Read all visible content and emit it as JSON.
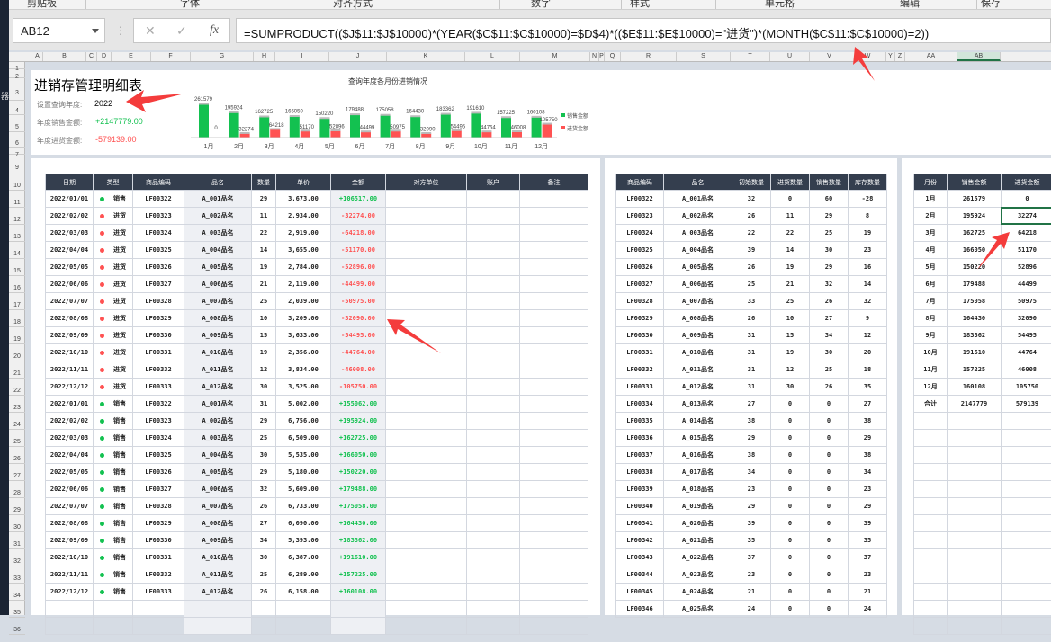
{
  "ribbon": {
    "groups": [
      "剪贴板",
      "字体",
      "对齐方式",
      "数字",
      "样式",
      "单元格",
      "编辑",
      "保存"
    ]
  },
  "desktop": {
    "label": "器"
  },
  "formula_bar": {
    "name_box": "AB12",
    "cancel_icon": "✕",
    "confirm_icon": "✓",
    "fx_label": "fx",
    "formula": "=SUMPRODUCT(($J$11:$J$10000)*(YEAR($C$11:$C$10000)=$D$4)*(($E$11:$E$10000)=\"进货\")*(MONTH($C$11:$C$10000)=2))"
  },
  "columns": [
    "A",
    "B",
    "C",
    "D",
    "E",
    "F",
    "G",
    "H",
    "I",
    "J",
    "K",
    "L",
    "M",
    "N",
    "P",
    "Q",
    "R",
    "S",
    "T",
    "U",
    "V",
    "W",
    "Y",
    "Z",
    "AA",
    "AB"
  ],
  "selected_column": "AB",
  "rows": [
    "1",
    "2",
    "3",
    "4",
    "5",
    "6",
    "7",
    "9",
    "10",
    "11",
    "12",
    "13",
    "14",
    "15",
    "16",
    "17",
    "18",
    "19",
    "20",
    "21",
    "22",
    "23",
    "24",
    "25",
    "26",
    "27",
    "28",
    "29",
    "30",
    "31",
    "32",
    "33",
    "34",
    "35",
    "36"
  ],
  "summary": {
    "title": "进销存管理明细表",
    "year_label": "设置查询年度:",
    "year": "2022",
    "sales_label": "年度销售金额:",
    "sales_total": "+2147779.00",
    "purchase_label": "年度进货金额:",
    "purchase_total": "-579139.00"
  },
  "colors": {
    "sales": "#13c150",
    "purchase": "#ff5252",
    "header": "#343e4e",
    "accent": "#217346"
  },
  "chart_data": {
    "type": "bar",
    "title": "查询年度各月份进销情况",
    "categories": [
      "1月",
      "2月",
      "3月",
      "4月",
      "5月",
      "6月",
      "7月",
      "8月",
      "9月",
      "10月",
      "11月",
      "12月"
    ],
    "series": [
      {
        "name": "销售金额",
        "color": "#13c150",
        "values": [
          261579,
          195924,
          162725,
          166050,
          150220,
          179488,
          175058,
          164430,
          183362,
          191610,
          157225,
          160108
        ]
      },
      {
        "name": "进货金额",
        "color": "#ff5252",
        "values": [
          0,
          32274,
          64218,
          51170,
          52896,
          44499,
          50975,
          32090,
          54495,
          44764,
          46008,
          105750
        ]
      }
    ],
    "legend": "right",
    "grid": false,
    "data_labels": true
  },
  "ledger": {
    "headers": [
      "日期",
      "类型",
      "商品编码",
      "品名",
      "数量",
      "单价",
      "金额",
      "对方单位",
      "账户",
      "备注"
    ],
    "rows": [
      [
        "2022/01/01",
        "销售",
        "LF00322",
        "A_001品名",
        "29",
        "3,673.00",
        "+106517.00"
      ],
      [
        "2022/02/02",
        "进货",
        "LF00323",
        "A_002品名",
        "11",
        "2,934.00",
        "-32274.00"
      ],
      [
        "2022/03/03",
        "进货",
        "LF00324",
        "A_003品名",
        "22",
        "2,919.00",
        "-64218.00"
      ],
      [
        "2022/04/04",
        "进货",
        "LF00325",
        "A_004品名",
        "14",
        "3,655.00",
        "-51170.00"
      ],
      [
        "2022/05/05",
        "进货",
        "LF00326",
        "A_005品名",
        "19",
        "2,784.00",
        "-52896.00"
      ],
      [
        "2022/06/06",
        "进货",
        "LF00327",
        "A_006品名",
        "21",
        "2,119.00",
        "-44499.00"
      ],
      [
        "2022/07/07",
        "进货",
        "LF00328",
        "A_007品名",
        "25",
        "2,039.00",
        "-50975.00"
      ],
      [
        "2022/08/08",
        "进货",
        "LF00329",
        "A_008品名",
        "10",
        "3,209.00",
        "-32090.00"
      ],
      [
        "2022/09/09",
        "进货",
        "LF00330",
        "A_009品名",
        "15",
        "3,633.00",
        "-54495.00"
      ],
      [
        "2022/10/10",
        "进货",
        "LF00331",
        "A_010品名",
        "19",
        "2,356.00",
        "-44764.00"
      ],
      [
        "2022/11/11",
        "进货",
        "LF00332",
        "A_011品名",
        "12",
        "3,834.00",
        "-46008.00"
      ],
      [
        "2022/12/12",
        "进货",
        "LF00333",
        "A_012品名",
        "30",
        "3,525.00",
        "-105750.00"
      ],
      [
        "2022/01/01",
        "销售",
        "LF00322",
        "A_001品名",
        "31",
        "5,002.00",
        "+155062.00"
      ],
      [
        "2022/02/02",
        "销售",
        "LF00323",
        "A_002品名",
        "29",
        "6,756.00",
        "+195924.00"
      ],
      [
        "2022/03/03",
        "销售",
        "LF00324",
        "A_003品名",
        "25",
        "6,509.00",
        "+162725.00"
      ],
      [
        "2022/04/04",
        "销售",
        "LF00325",
        "A_004品名",
        "30",
        "5,535.00",
        "+166050.00"
      ],
      [
        "2022/05/05",
        "销售",
        "LF00326",
        "A_005品名",
        "29",
        "5,180.00",
        "+150220.00"
      ],
      [
        "2022/06/06",
        "销售",
        "LF00327",
        "A_006品名",
        "32",
        "5,609.00",
        "+179488.00"
      ],
      [
        "2022/07/07",
        "销售",
        "LF00328",
        "A_007品名",
        "26",
        "6,733.00",
        "+175058.00"
      ],
      [
        "2022/08/08",
        "销售",
        "LF00329",
        "A_008品名",
        "27",
        "6,090.00",
        "+164430.00"
      ],
      [
        "2022/09/09",
        "销售",
        "LF00330",
        "A_009品名",
        "34",
        "5,393.00",
        "+183362.00"
      ],
      [
        "2022/10/10",
        "销售",
        "LF00331",
        "A_010品名",
        "30",
        "6,387.00",
        "+191610.00"
      ],
      [
        "2022/11/11",
        "销售",
        "LF00332",
        "A_011品名",
        "25",
        "6,289.00",
        "+157225.00"
      ],
      [
        "2022/12/12",
        "销售",
        "LF00333",
        "A_012品名",
        "26",
        "6,158.00",
        "+160108.00"
      ]
    ]
  },
  "stock": {
    "headers": [
      "商品编码",
      "品名",
      "初始数量",
      "进货数量",
      "销售数量",
      "库存数量"
    ],
    "rows": [
      [
        "LF00322",
        "A_001品名",
        "32",
        "0",
        "60",
        "-28"
      ],
      [
        "LF00323",
        "A_002品名",
        "26",
        "11",
        "29",
        "8"
      ],
      [
        "LF00324",
        "A_003品名",
        "22",
        "22",
        "25",
        "19"
      ],
      [
        "LF00325",
        "A_004品名",
        "39",
        "14",
        "30",
        "23"
      ],
      [
        "LF00326",
        "A_005品名",
        "26",
        "19",
        "29",
        "16"
      ],
      [
        "LF00327",
        "A_006品名",
        "25",
        "21",
        "32",
        "14"
      ],
      [
        "LF00328",
        "A_007品名",
        "33",
        "25",
        "26",
        "32"
      ],
      [
        "LF00329",
        "A_008品名",
        "26",
        "10",
        "27",
        "9"
      ],
      [
        "LF00330",
        "A_009品名",
        "31",
        "15",
        "34",
        "12"
      ],
      [
        "LF00331",
        "A_010品名",
        "31",
        "19",
        "30",
        "20"
      ],
      [
        "LF00332",
        "A_011品名",
        "31",
        "12",
        "25",
        "18"
      ],
      [
        "LF00333",
        "A_012品名",
        "31",
        "30",
        "26",
        "35"
      ],
      [
        "LF00334",
        "A_013品名",
        "27",
        "0",
        "0",
        "27"
      ],
      [
        "LF00335",
        "A_014品名",
        "38",
        "0",
        "0",
        "38"
      ],
      [
        "LF00336",
        "A_015品名",
        "29",
        "0",
        "0",
        "29"
      ],
      [
        "LF00337",
        "A_016品名",
        "38",
        "0",
        "0",
        "38"
      ],
      [
        "LF00338",
        "A_017品名",
        "34",
        "0",
        "0",
        "34"
      ],
      [
        "LF00339",
        "A_018品名",
        "23",
        "0",
        "0",
        "23"
      ],
      [
        "LF00340",
        "A_019品名",
        "29",
        "0",
        "0",
        "29"
      ],
      [
        "LF00341",
        "A_020品名",
        "39",
        "0",
        "0",
        "39"
      ],
      [
        "LF00342",
        "A_021品名",
        "35",
        "0",
        "0",
        "35"
      ],
      [
        "LF00343",
        "A_022品名",
        "37",
        "0",
        "0",
        "37"
      ],
      [
        "LF00344",
        "A_023品名",
        "23",
        "0",
        "0",
        "23"
      ],
      [
        "LF00345",
        "A_024品名",
        "21",
        "0",
        "0",
        "21"
      ],
      [
        "LF00346",
        "A_025品名",
        "24",
        "0",
        "0",
        "24"
      ]
    ]
  },
  "monthly": {
    "headers": [
      "月份",
      "销售金额",
      "进货金额"
    ],
    "rows": [
      [
        "1月",
        "261579",
        "0"
      ],
      [
        "2月",
        "195924",
        "32274"
      ],
      [
        "3月",
        "162725",
        "64218"
      ],
      [
        "4月",
        "166050",
        "51170"
      ],
      [
        "5月",
        "150220",
        "52896"
      ],
      [
        "6月",
        "179488",
        "44499"
      ],
      [
        "7月",
        "175058",
        "50975"
      ],
      [
        "8月",
        "164430",
        "32090"
      ],
      [
        "9月",
        "183362",
        "54495"
      ],
      [
        "10月",
        "191610",
        "44764"
      ],
      [
        "11月",
        "157225",
        "46008"
      ],
      [
        "12月",
        "160108",
        "105750"
      ],
      [
        "合计",
        "2147779",
        "579139"
      ]
    ]
  }
}
